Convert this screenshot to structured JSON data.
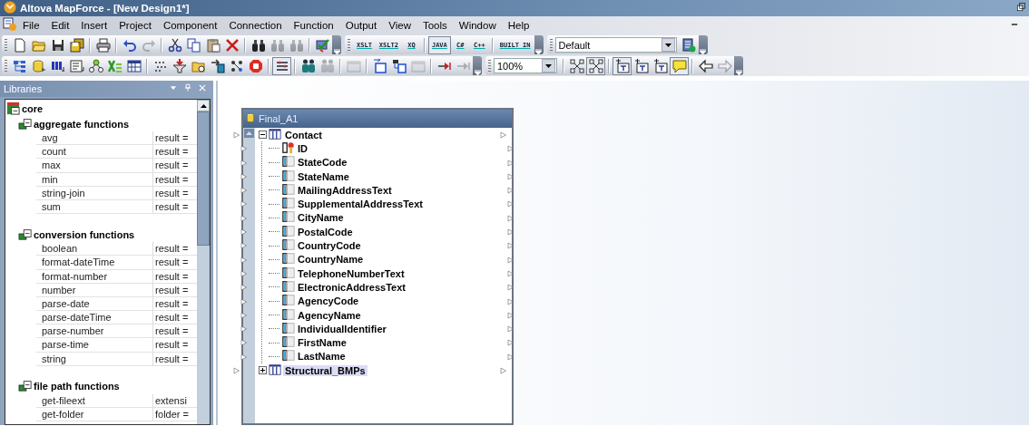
{
  "window": {
    "title": "Altova MapForce - [New Design1*]"
  },
  "menu": [
    "File",
    "Edit",
    "Insert",
    "Project",
    "Component",
    "Connection",
    "Function",
    "Output",
    "View",
    "Tools",
    "Window",
    "Help"
  ],
  "toolbar_rows": [
    {
      "bars": [
        {
          "items": [
            {
              "kind": "icon",
              "disabled": false,
              "on": false
            },
            {
              "kind": "icon",
              "disabled": false,
              "on": false
            },
            {
              "kind": "icon",
              "disabled": false,
              "on": false
            },
            {
              "kind": "icon",
              "disabled": false,
              "on": false
            },
            {
              "kind": "separator"
            },
            {
              "kind": "icon",
              "disabled": false,
              "on": false
            },
            {
              "kind": "separator"
            },
            {
              "kind": "icon",
              "disabled": false,
              "on": false
            },
            {
              "kind": "icon",
              "disabled": true,
              "on": false
            },
            {
              "kind": "separator"
            },
            {
              "kind": "icon",
              "disabled": false,
              "on": false
            },
            {
              "kind": "icon",
              "disabled": false,
              "on": false
            },
            {
              "kind": "icon",
              "disabled": false,
              "on": false
            },
            {
              "kind": "icon",
              "disabled": false,
              "on": false
            },
            {
              "kind": "separator"
            },
            {
              "kind": "icon",
              "disabled": false,
              "on": false
            },
            {
              "kind": "icon",
              "disabled": true,
              "on": false
            },
            {
              "kind": "icon",
              "disabled": true,
              "on": false
            },
            {
              "kind": "separator"
            },
            {
              "kind": "icon",
              "disabled": false,
              "on": false
            }
          ]
        },
        {
          "items": [
            {
              "kind": "text",
              "label": "XSLT",
              "on": false
            },
            {
              "kind": "text",
              "label": "XSLT2",
              "on": false
            },
            {
              "kind": "text",
              "label": "XQ",
              "on": false
            },
            {
              "kind": "separator"
            },
            {
              "kind": "text",
              "label": "JAVA",
              "on": true
            },
            {
              "kind": "text",
              "label": "C#",
              "on": false
            },
            {
              "kind": "text",
              "label": "C++",
              "on": false
            },
            {
              "kind": "separator"
            },
            {
              "kind": "text",
              "label": "BUILT IN",
              "on": false
            }
          ]
        },
        {
          "items": [
            {
              "kind": "dropdown",
              "value": "Default",
              "wide": true
            },
            {
              "kind": "icon",
              "disabled": false,
              "on": false
            }
          ]
        }
      ]
    },
    {
      "bars": [
        {
          "items": [
            {
              "kind": "icon",
              "disabled": false,
              "on": false
            },
            {
              "kind": "icon",
              "disabled": false,
              "on": false
            },
            {
              "kind": "icon",
              "disabled": false,
              "on": false
            },
            {
              "kind": "icon",
              "disabled": false,
              "on": false
            },
            {
              "kind": "icon",
              "disabled": false,
              "on": false
            },
            {
              "kind": "icon",
              "disabled": false,
              "on": false
            },
            {
              "kind": "icon",
              "disabled": false,
              "on": false
            },
            {
              "kind": "separator"
            },
            {
              "kind": "icon",
              "disabled": false,
              "on": false
            },
            {
              "kind": "icon",
              "disabled": false,
              "on": false
            },
            {
              "kind": "icon",
              "disabled": false,
              "on": false
            },
            {
              "kind": "icon",
              "disabled": false,
              "on": false
            },
            {
              "kind": "icon",
              "disabled": false,
              "on": false
            },
            {
              "kind": "icon",
              "disabled": false,
              "on": false
            },
            {
              "kind": "separator"
            },
            {
              "kind": "icon",
              "disabled": false,
              "on": true
            },
            {
              "kind": "separator"
            },
            {
              "kind": "icon",
              "disabled": false,
              "on": false
            },
            {
              "kind": "icon",
              "disabled": true,
              "on": false
            },
            {
              "kind": "separator"
            },
            {
              "kind": "icon",
              "disabled": true,
              "on": false
            },
            {
              "kind": "separator"
            },
            {
              "kind": "icon",
              "disabled": false,
              "on": false
            },
            {
              "kind": "icon",
              "disabled": false,
              "on": false
            },
            {
              "kind": "icon",
              "disabled": true,
              "on": false
            },
            {
              "kind": "separator"
            },
            {
              "kind": "icon",
              "disabled": false,
              "on": false
            },
            {
              "kind": "icon",
              "disabled": true,
              "on": false
            }
          ]
        },
        {
          "items": [
            {
              "kind": "dropdown",
              "value": "100%",
              "wide": false
            },
            {
              "kind": "separator"
            },
            {
              "kind": "icon",
              "disabled": false,
              "on": false
            },
            {
              "kind": "icon",
              "disabled": false,
              "on": true
            },
            {
              "kind": "separator"
            },
            {
              "kind": "icon",
              "disabled": false,
              "on": true
            },
            {
              "kind": "icon",
              "disabled": false,
              "on": false
            },
            {
              "kind": "icon",
              "disabled": false,
              "on": false
            },
            {
              "kind": "icon",
              "disabled": false,
              "on": true
            },
            {
              "kind": "separator"
            },
            {
              "kind": "icon",
              "disabled": false,
              "on": false
            },
            {
              "kind": "icon",
              "disabled": true,
              "on": false
            }
          ]
        }
      ]
    }
  ],
  "libraries": {
    "title": "Libraries",
    "root": "core",
    "groups": [
      {
        "name": "aggregate functions",
        "functions": [
          {
            "name": "avg",
            "signature": "result ="
          },
          {
            "name": "count",
            "signature": "result ="
          },
          {
            "name": "max",
            "signature": "result ="
          },
          {
            "name": "min",
            "signature": "result ="
          },
          {
            "name": "string-join",
            "signature": "result ="
          },
          {
            "name": "sum",
            "signature": "result ="
          }
        ]
      },
      {
        "name": "conversion functions",
        "functions": [
          {
            "name": "boolean",
            "signature": "result ="
          },
          {
            "name": "format-dateTime",
            "signature": "result ="
          },
          {
            "name": "format-number",
            "signature": "result ="
          },
          {
            "name": "number",
            "signature": "result ="
          },
          {
            "name": "parse-date",
            "signature": "result ="
          },
          {
            "name": "parse-dateTime",
            "signature": "result ="
          },
          {
            "name": "parse-number",
            "signature": "result ="
          },
          {
            "name": "parse-time",
            "signature": "result ="
          },
          {
            "name": "string",
            "signature": "result ="
          }
        ]
      },
      {
        "name": "file path functions",
        "functions": [
          {
            "name": "get-fileext",
            "signature": "extensi"
          },
          {
            "name": "get-folder",
            "signature": "folder ="
          }
        ]
      }
    ]
  },
  "component": {
    "title": "Final_A1",
    "tree": [
      {
        "label": "Contact",
        "expanded": true,
        "selected": false,
        "children": [
          {
            "label": "ID",
            "kind": "key",
            "selected": false
          },
          {
            "label": "StateCode",
            "kind": "field",
            "selected": false
          },
          {
            "label": "StateName",
            "kind": "field",
            "selected": false
          },
          {
            "label": "MailingAddressText",
            "kind": "field",
            "selected": false
          },
          {
            "label": "SupplementalAddressText",
            "kind": "field",
            "selected": false
          },
          {
            "label": "CityName",
            "kind": "field",
            "selected": false
          },
          {
            "label": "PostalCode",
            "kind": "field",
            "selected": false
          },
          {
            "label": "CountryCode",
            "kind": "field",
            "selected": false
          },
          {
            "label": "CountryName",
            "kind": "field",
            "selected": false
          },
          {
            "label": "TelephoneNumberText",
            "kind": "field",
            "selected": false
          },
          {
            "label": "ElectronicAddressText",
            "kind": "field",
            "selected": false
          },
          {
            "label": "AgencyCode",
            "kind": "field",
            "selected": false
          },
          {
            "label": "AgencyName",
            "kind": "field",
            "selected": false
          },
          {
            "label": "IndividualIdentifier",
            "kind": "field",
            "selected": false
          },
          {
            "label": "FirstName",
            "kind": "field",
            "selected": false
          },
          {
            "label": "LastName",
            "kind": "field",
            "selected": false
          }
        ]
      },
      {
        "label": "Structural_BMPs",
        "expanded": false,
        "selected": true
      }
    ]
  }
}
